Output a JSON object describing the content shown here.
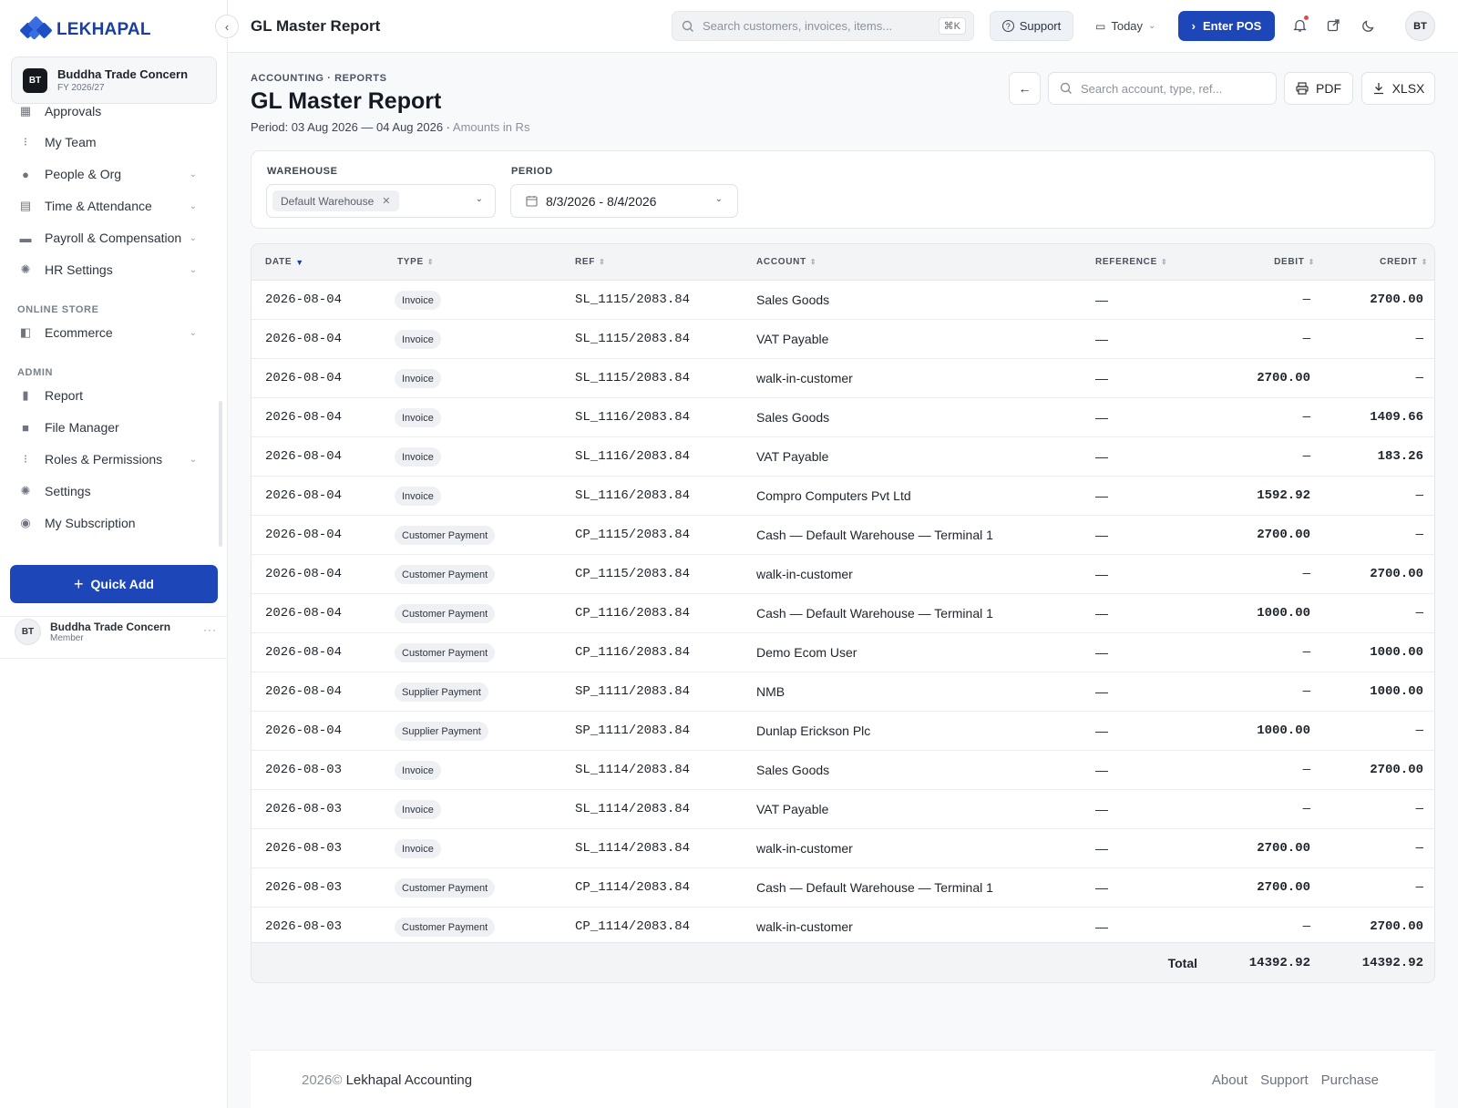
{
  "brand": {
    "name": "LEKHAPAL"
  },
  "org": {
    "initials": "BT",
    "name": "Buddha Trade Concern",
    "fy": "FY 2026/27"
  },
  "sidebar": {
    "items": [
      {
        "label": "Approvals",
        "icon": "approvals-icon",
        "chevron": false
      },
      {
        "label": "My Team",
        "icon": "team-icon",
        "chevron": false
      },
      {
        "label": "People & Org",
        "icon": "people-icon",
        "chevron": true
      },
      {
        "label": "Time & Attendance",
        "icon": "calendar-icon",
        "chevron": true
      },
      {
        "label": "Payroll & Compensation",
        "icon": "payroll-icon",
        "chevron": true
      },
      {
        "label": "HR Settings",
        "icon": "gear-icon",
        "chevron": true
      }
    ],
    "online_store_label": "ONLINE STORE",
    "store_items": [
      {
        "label": "Ecommerce",
        "icon": "store-icon",
        "chevron": true
      }
    ],
    "admin_label": "ADMIN",
    "admin_items": [
      {
        "label": "Report",
        "icon": "chart-icon",
        "chevron": false
      },
      {
        "label": "File Manager",
        "icon": "folder-icon",
        "chevron": false
      },
      {
        "label": "Roles & Permissions",
        "icon": "roles-icon",
        "chevron": true
      },
      {
        "label": "Settings",
        "icon": "settings-icon",
        "chevron": false
      },
      {
        "label": "My Subscription",
        "icon": "subscription-icon",
        "chevron": false
      }
    ],
    "quick_add": "Quick Add",
    "user": {
      "initials": "BT",
      "name": "Buddha Trade Concern",
      "role": "Member"
    }
  },
  "topbar": {
    "title": "GL Master Report",
    "search_placeholder": "Search customers, invoices, items...",
    "shortcut": "⌘K",
    "support": "Support",
    "today": "Today",
    "enter_pos": "Enter POS",
    "avatar": "BT"
  },
  "header": {
    "breadcrumb": "ACCOUNTING · REPORTS",
    "title": "GL Master Report",
    "period": "Period: 03 Aug 2026 — 04 Aug 2026 · ",
    "amounts": "Amounts in Rs",
    "search_placeholder": "Search account, type, ref...",
    "pdf": "PDF",
    "xlsx": "XLSX"
  },
  "filters": {
    "warehouse_label": "WAREHOUSE",
    "warehouse_value": "Default Warehouse",
    "period_label": "PERIOD",
    "period_value": "8/3/2026 - 8/4/2026"
  },
  "table": {
    "columns": [
      "DATE",
      "TYPE",
      "REF",
      "ACCOUNT",
      "REFERENCE",
      "DEBIT",
      "CREDIT"
    ],
    "rows": [
      {
        "date": "2026-08-04",
        "type": "Invoice",
        "ref": "SL_1115/2083.84",
        "account": "Sales Goods",
        "reference": "—",
        "debit": "—",
        "credit": "2700.00"
      },
      {
        "date": "2026-08-04",
        "type": "Invoice",
        "ref": "SL_1115/2083.84",
        "account": "VAT Payable",
        "reference": "—",
        "debit": "—",
        "credit": "—"
      },
      {
        "date": "2026-08-04",
        "type": "Invoice",
        "ref": "SL_1115/2083.84",
        "account": "walk-in-customer",
        "reference": "—",
        "debit": "2700.00",
        "credit": "—"
      },
      {
        "date": "2026-08-04",
        "type": "Invoice",
        "ref": "SL_1116/2083.84",
        "account": "Sales Goods",
        "reference": "—",
        "debit": "—",
        "credit": "1409.66"
      },
      {
        "date": "2026-08-04",
        "type": "Invoice",
        "ref": "SL_1116/2083.84",
        "account": "VAT Payable",
        "reference": "—",
        "debit": "—",
        "credit": "183.26"
      },
      {
        "date": "2026-08-04",
        "type": "Invoice",
        "ref": "SL_1116/2083.84",
        "account": "Compro Computers Pvt Ltd",
        "reference": "—",
        "debit": "1592.92",
        "credit": "—"
      },
      {
        "date": "2026-08-04",
        "type": "Customer Payment",
        "ref": "CP_1115/2083.84",
        "account": "Cash — Default Warehouse — Terminal 1",
        "reference": "—",
        "debit": "2700.00",
        "credit": "—"
      },
      {
        "date": "2026-08-04",
        "type": "Customer Payment",
        "ref": "CP_1115/2083.84",
        "account": "walk-in-customer",
        "reference": "—",
        "debit": "—",
        "credit": "2700.00"
      },
      {
        "date": "2026-08-04",
        "type": "Customer Payment",
        "ref": "CP_1116/2083.84",
        "account": "Cash — Default Warehouse — Terminal 1",
        "reference": "—",
        "debit": "1000.00",
        "credit": "—"
      },
      {
        "date": "2026-08-04",
        "type": "Customer Payment",
        "ref": "CP_1116/2083.84",
        "account": "Demo Ecom User",
        "reference": "—",
        "debit": "—",
        "credit": "1000.00"
      },
      {
        "date": "2026-08-04",
        "type": "Supplier Payment",
        "ref": "SP_1111/2083.84",
        "account": "NMB",
        "reference": "—",
        "debit": "—",
        "credit": "1000.00"
      },
      {
        "date": "2026-08-04",
        "type": "Supplier Payment",
        "ref": "SP_1111/2083.84",
        "account": "Dunlap Erickson Plc",
        "reference": "—",
        "debit": "1000.00",
        "credit": "—"
      },
      {
        "date": "2026-08-03",
        "type": "Invoice",
        "ref": "SL_1114/2083.84",
        "account": "Sales Goods",
        "reference": "—",
        "debit": "—",
        "credit": "2700.00"
      },
      {
        "date": "2026-08-03",
        "type": "Invoice",
        "ref": "SL_1114/2083.84",
        "account": "VAT Payable",
        "reference": "—",
        "debit": "—",
        "credit": "—"
      },
      {
        "date": "2026-08-03",
        "type": "Invoice",
        "ref": "SL_1114/2083.84",
        "account": "walk-in-customer",
        "reference": "—",
        "debit": "2700.00",
        "credit": "—"
      },
      {
        "date": "2026-08-03",
        "type": "Customer Payment",
        "ref": "CP_1114/2083.84",
        "account": "Cash — Default Warehouse — Terminal 1",
        "reference": "—",
        "debit": "2700.00",
        "credit": "—"
      },
      {
        "date": "2026-08-03",
        "type": "Customer Payment",
        "ref": "CP_1114/2083.84",
        "account": "walk-in-customer",
        "reference": "—",
        "debit": "—",
        "credit": "2700.00"
      }
    ],
    "total_label": "Total",
    "total_debit": "14392.92",
    "total_credit": "14392.92"
  },
  "footer": {
    "year": "2026©",
    "company": "Lekhapal Accounting",
    "links": [
      "About",
      "Support",
      "Purchase"
    ]
  }
}
